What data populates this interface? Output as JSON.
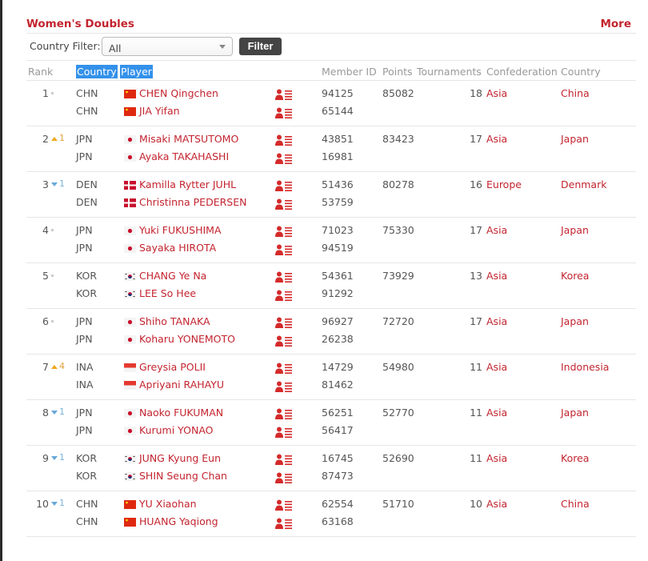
{
  "section": {
    "title": "Women's Doubles",
    "more_label": "More"
  },
  "filter": {
    "label": "Country Filter:",
    "selected": "All",
    "button_label": "Filter"
  },
  "columns": {
    "rank": "Rank",
    "country": "Country",
    "player": "Player",
    "member_id": "Member ID",
    "points": "Points",
    "tournaments": "Tournaments",
    "confederation": "Confederation",
    "country_name": "Country"
  },
  "colors": {
    "accent": "#c3242f",
    "highlight": "#3391ea",
    "up": "#f0a81f",
    "down": "#66a8d8"
  },
  "icons": {
    "profile": "player-profile-icon",
    "up": "arrow-up-icon",
    "down": "arrow-down-icon",
    "same": "no-change-icon"
  },
  "rows": [
    {
      "rank": "1",
      "trend": "same",
      "change": "",
      "points": "85082",
      "tournaments": "18",
      "confederation": "Asia",
      "country": "China",
      "players": [
        {
          "code": "CHN",
          "flag": "chn",
          "name": "CHEN Qingchen",
          "member_id": "94125"
        },
        {
          "code": "CHN",
          "flag": "chn",
          "name": "JIA Yifan",
          "member_id": "65144"
        }
      ]
    },
    {
      "rank": "2",
      "trend": "up",
      "change": "1",
      "points": "83423",
      "tournaments": "17",
      "confederation": "Asia",
      "country": "Japan",
      "players": [
        {
          "code": "JPN",
          "flag": "jpn",
          "name": "Misaki MATSUTOMO",
          "member_id": "43851"
        },
        {
          "code": "JPN",
          "flag": "jpn",
          "name": "Ayaka TAKAHASHI",
          "member_id": "16981"
        }
      ]
    },
    {
      "rank": "3",
      "trend": "down",
      "change": "1",
      "points": "80278",
      "tournaments": "16",
      "confederation": "Europe",
      "country": "Denmark",
      "players": [
        {
          "code": "DEN",
          "flag": "den",
          "name": "Kamilla Rytter JUHL",
          "member_id": "51436"
        },
        {
          "code": "DEN",
          "flag": "den",
          "name": "Christinna PEDERSEN",
          "member_id": "53759"
        }
      ]
    },
    {
      "rank": "4",
      "trend": "same",
      "change": "",
      "points": "75330",
      "tournaments": "17",
      "confederation": "Asia",
      "country": "Japan",
      "players": [
        {
          "code": "JPN",
          "flag": "jpn",
          "name": "Yuki FUKUSHIMA",
          "member_id": "71023"
        },
        {
          "code": "JPN",
          "flag": "jpn",
          "name": "Sayaka HIROTA",
          "member_id": "94519"
        }
      ]
    },
    {
      "rank": "5",
      "trend": "same",
      "change": "",
      "points": "73929",
      "tournaments": "13",
      "confederation": "Asia",
      "country": "Korea",
      "players": [
        {
          "code": "KOR",
          "flag": "kor",
          "name": "CHANG Ye Na",
          "member_id": "54361"
        },
        {
          "code": "KOR",
          "flag": "kor",
          "name": "LEE So Hee",
          "member_id": "91292"
        }
      ]
    },
    {
      "rank": "6",
      "trend": "same",
      "change": "",
      "points": "72720",
      "tournaments": "17",
      "confederation": "Asia",
      "country": "Japan",
      "players": [
        {
          "code": "JPN",
          "flag": "jpn",
          "name": "Shiho TANAKA",
          "member_id": "96927"
        },
        {
          "code": "JPN",
          "flag": "jpn",
          "name": "Koharu YONEMOTO",
          "member_id": "26238"
        }
      ]
    },
    {
      "rank": "7",
      "trend": "up",
      "change": "4",
      "points": "54980",
      "tournaments": "11",
      "confederation": "Asia",
      "country": "Indonesia",
      "players": [
        {
          "code": "INA",
          "flag": "ina",
          "name": "Greysia POLII",
          "member_id": "14729"
        },
        {
          "code": "INA",
          "flag": "ina",
          "name": "Apriyani RAHAYU",
          "member_id": "81462"
        }
      ]
    },
    {
      "rank": "8",
      "trend": "down",
      "change": "1",
      "points": "52770",
      "tournaments": "11",
      "confederation": "Asia",
      "country": "Japan",
      "players": [
        {
          "code": "JPN",
          "flag": "jpn",
          "name": "Naoko FUKUMAN",
          "member_id": "56251"
        },
        {
          "code": "JPN",
          "flag": "jpn",
          "name": "Kurumi YONAO",
          "member_id": "56417"
        }
      ]
    },
    {
      "rank": "9",
      "trend": "down",
      "change": "1",
      "points": "52690",
      "tournaments": "11",
      "confederation": "Asia",
      "country": "Korea",
      "players": [
        {
          "code": "KOR",
          "flag": "kor",
          "name": "JUNG Kyung Eun",
          "member_id": "16745"
        },
        {
          "code": "KOR",
          "flag": "kor",
          "name": "SHIN Seung Chan",
          "member_id": "87473"
        }
      ]
    },
    {
      "rank": "10",
      "trend": "down",
      "change": "1",
      "points": "51710",
      "tournaments": "10",
      "confederation": "Asia",
      "country": "China",
      "players": [
        {
          "code": "CHN",
          "flag": "chn",
          "name": "YU Xiaohan",
          "member_id": "62554"
        },
        {
          "code": "CHN",
          "flag": "chn",
          "name": "HUANG Yaqiong",
          "member_id": "63168"
        }
      ]
    }
  ]
}
